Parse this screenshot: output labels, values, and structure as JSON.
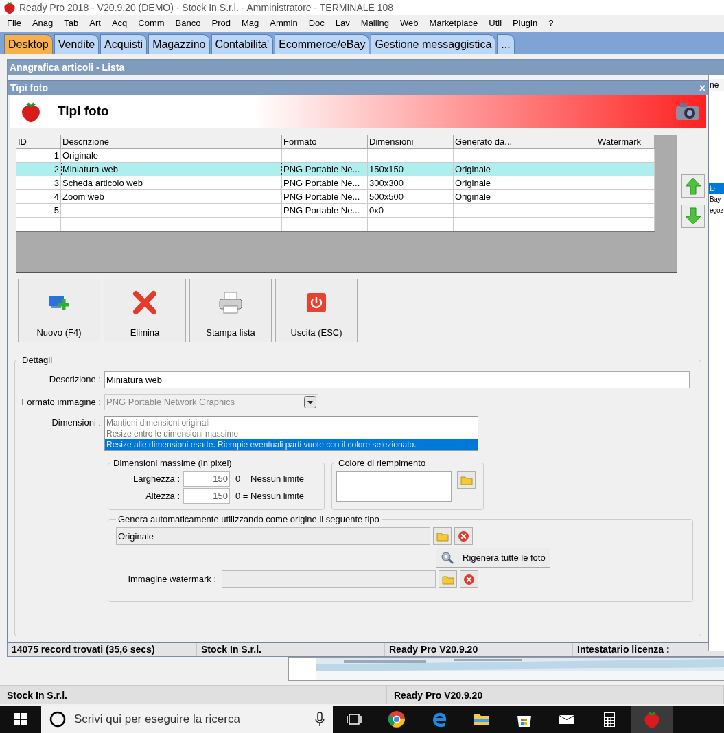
{
  "window": {
    "title": "Ready Pro 2018 - V20.9.20 (DEMO)  - Stock In S.r.l. - Amministratore - TERMINALE 108"
  },
  "menu": [
    "File",
    "Anag",
    "Tab",
    "Art",
    "Acq",
    "Comm",
    "Banco",
    "Prod",
    "Mag",
    "Ammin",
    "Doc",
    "Lav",
    "Mailing",
    "Web",
    "Marketplace",
    "Util",
    "Plugin",
    "?"
  ],
  "tabs": [
    {
      "label": "Desktop",
      "selected": true
    },
    {
      "label": "Vendite",
      "selected": false
    },
    {
      "label": "Acquisti",
      "selected": false
    },
    {
      "label": "Magazzino",
      "selected": false
    },
    {
      "label": "Contabilita'",
      "selected": false
    },
    {
      "label": "Ecommerce/eBay",
      "selected": false
    },
    {
      "label": "Gestione messaggistica",
      "selected": false
    },
    {
      "label": "...",
      "selected": false
    }
  ],
  "background_window": {
    "title": "Anagrafica articoli  - Lista",
    "list_header": "ne",
    "list_items": [
      {
        "label": "to",
        "selected": true
      },
      {
        "label": "Bay",
        "selected": false
      },
      {
        "label": "egoz",
        "selected": false
      }
    ],
    "status_bar": [
      "14075 record trovati (35,6 secs)",
      "Stock In S.r.l.",
      "Ready Pro V20.9.20",
      "Intestatario licenza :"
    ]
  },
  "dialog": {
    "title": "Tipi foto",
    "close": "×",
    "header_title": "Tipi foto",
    "table": {
      "columns": [
        "ID",
        "Descrizione",
        "Formato",
        "Dimensioni",
        "Generato da...",
        "Watermark"
      ],
      "rows": [
        {
          "id": "1",
          "descrizione": "Originale",
          "selected": false
        },
        {
          "id": "2",
          "descrizione": "Miniatura web",
          "formato": "PNG Portable Ne...",
          "dimensioni": "150x150",
          "generato_da": "Originale",
          "selected": true
        },
        {
          "id": "3",
          "descrizione": "Scheda articolo web",
          "formato": "PNG Portable Ne...",
          "dimensioni": "300x300",
          "generato_da": "Originale",
          "selected": false
        },
        {
          "id": "4",
          "descrizione": "Zoom web",
          "formato": "PNG Portable Ne...",
          "dimensioni": "500x500",
          "generato_da": "Originale",
          "selected": false
        },
        {
          "id": "5",
          "formato": "PNG Portable Ne...",
          "dimensioni": "0x0",
          "selected": false
        }
      ]
    },
    "toolbar": [
      {
        "label": "Nuovo (F4)",
        "kind": "new"
      },
      {
        "label": "Elimina",
        "kind": "delete"
      },
      {
        "label": "Stampa lista",
        "kind": "print"
      },
      {
        "label": "Uscita (ESC)",
        "kind": "exit"
      }
    ],
    "details": {
      "title": "Dettagli",
      "descrizione": {
        "label": "Descrizione :",
        "value": "Miniatura web"
      },
      "formato": {
        "label": "Formato immagine :",
        "value": "PNG Portable Network Graphics",
        "disabled": true
      },
      "dimensioni": {
        "label": "Dimensioni :",
        "options": [
          {
            "label": "Mantieni dimensioni originali",
            "selected": false
          },
          {
            "label": "Resize entro le dimensioni massime",
            "selected": false
          },
          {
            "label": "Resize alle dimensioni esatte. Riempie eventuali parti vuote con il colore selezionato.",
            "selected": true
          }
        ]
      },
      "max_size": {
        "title": "Dimensioni massime (in pixel)",
        "fields": [
          {
            "label": "Larghezza :",
            "value": "150",
            "hint": "0 = Nessun limite"
          },
          {
            "label": "Altezza :",
            "value": "150",
            "hint": "0 = Nessun limite"
          }
        ]
      },
      "fill_color": {
        "title": "Colore di riempimento"
      },
      "generate": {
        "title": "Genera automaticamente utilizzando come origine il seguente tipo",
        "source": "Originale",
        "regenerate_button": "Rigenera tutte le foto",
        "watermark_label": "Immagine watermark :"
      }
    }
  },
  "status_bar": [
    "Stock In S.r.l.",
    "Ready Pro V20.9.20"
  ],
  "taskbar": {
    "search_placeholder": "Scrivi qui per eseguire la ricerca"
  }
}
